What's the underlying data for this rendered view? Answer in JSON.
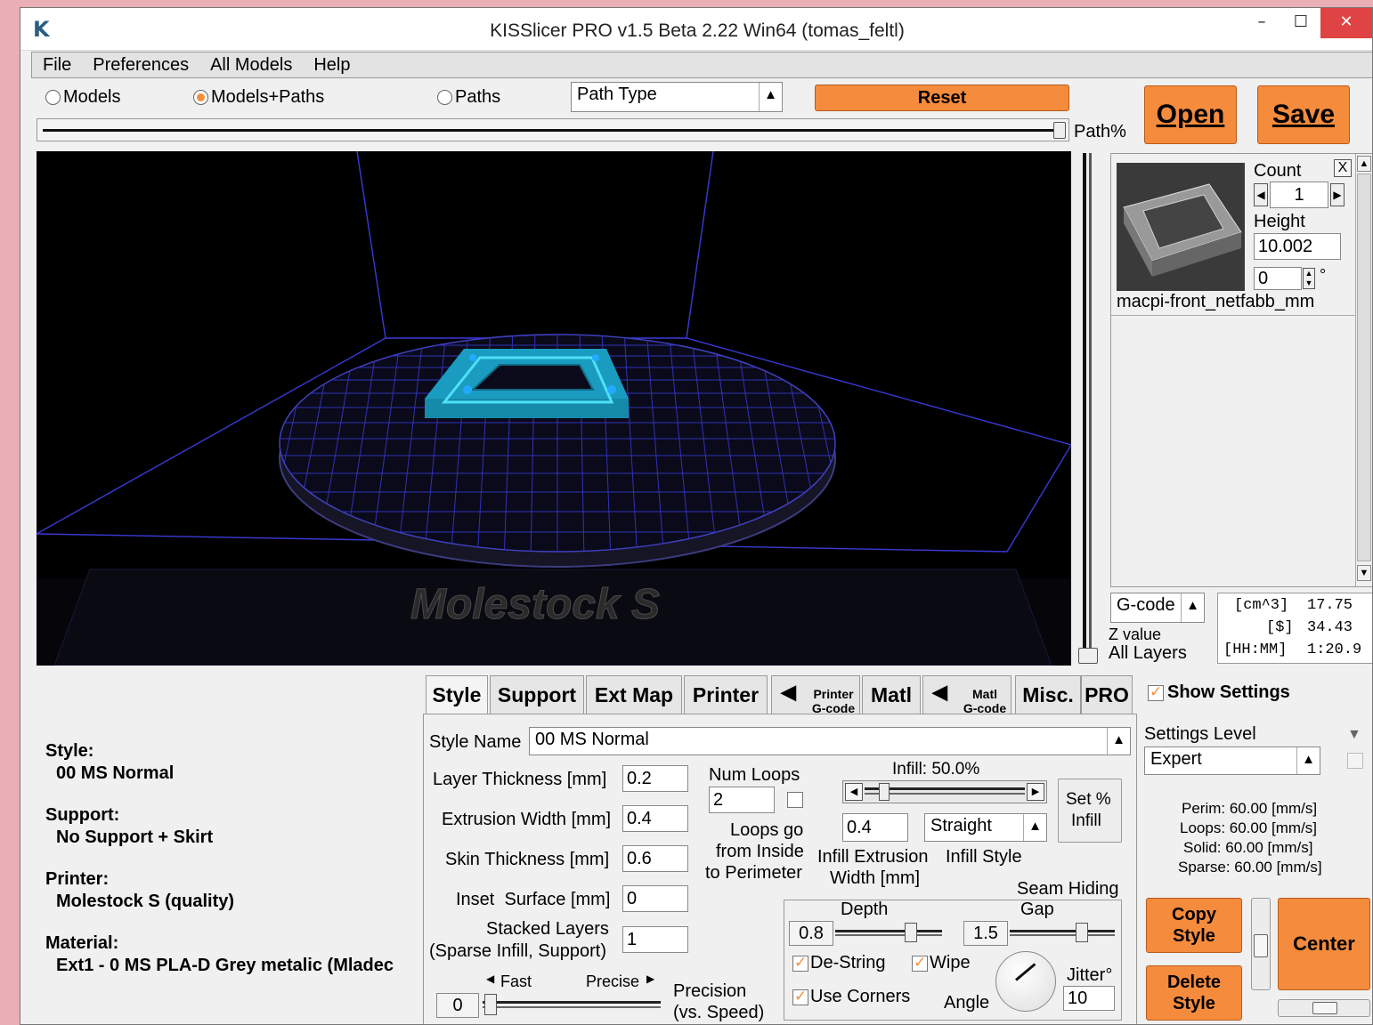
{
  "window": {
    "title": "KISSlicer PRO v1.5 Beta 2.22 Win64 (tomas_feltl)",
    "app_icon": "K"
  },
  "titlebar_buttons": {
    "minimize": "–",
    "maximize": "☐",
    "close": "✕"
  },
  "menu": [
    "File",
    "Preferences",
    "All Models",
    "Help"
  ],
  "view_modes": [
    {
      "label": "Models",
      "selected": false
    },
    {
      "label": "Models+Paths",
      "selected": true
    },
    {
      "label": "Paths",
      "selected": false
    }
  ],
  "path_type": {
    "value": "Path Type"
  },
  "reset_label": "Reset",
  "open_label": "Open",
  "save_label": "Save",
  "path_slider": {
    "label": "Path%",
    "value_percent": 100
  },
  "viewport": {
    "bed_label": "Molestock S"
  },
  "model_panel": {
    "count_label": "Count",
    "count": "1",
    "close_label": "X",
    "height_label": "Height",
    "height": "10.002",
    "rotation": "0",
    "degree": "°",
    "model_name": "macpi-front_netfabb_mm"
  },
  "gcode_select": {
    "value": "G-code"
  },
  "z_value_label": "Z value",
  "z_value": "All Layers",
  "stats": {
    "volume_label": "[cm^3]",
    "volume": "17.75",
    "cost_label": "[$]",
    "cost": "34.43",
    "time_label": "[HH:MM]",
    "time": "1:20.9"
  },
  "summary": {
    "style_label": "Style:",
    "style": "00 MS Normal",
    "support_label": "Support:",
    "support": "No Support + Skirt",
    "printer_label": "Printer:",
    "printer": "Molestock S (quality)",
    "material_label": "Material:",
    "material": "Ext1 - 0 MS PLA-D Grey metalic (Mladec"
  },
  "tabs": {
    "style": "Style",
    "support": "Support",
    "ext_map": "Ext Map",
    "printer": "Printer",
    "printer_gcode_1": "Printer",
    "printer_gcode_2": "G-code",
    "matl": "Matl",
    "matl_gcode_1": "Matl",
    "matl_gcode_2": "G-code",
    "misc": "Misc.",
    "pro": "PRO"
  },
  "style_tab": {
    "style_name_label": "Style Name",
    "style_name": "00 MS Normal",
    "layer_thickness_label": "Layer Thickness [mm]",
    "layer_thickness": "0.2",
    "extrusion_width_label": "Extrusion Width [mm]",
    "extrusion_width": "0.4",
    "skin_thickness_label": "Skin Thickness [mm]",
    "skin_thickness": "0.6",
    "inset_surface_label": "Inset  Surface [mm]",
    "inset_surface": "0",
    "stacked_layers_label_1": "Stacked Layers",
    "stacked_layers_label_2": "(Sparse Infill, Support)",
    "stacked_layers": "1",
    "num_loops_label": "Num Loops",
    "num_loops": "2",
    "loops_go_1": "Loops go",
    "loops_go_2": "from Inside",
    "loops_go_3": "to Perimeter",
    "infill_label": "Infill: 50.0%",
    "infill_percent": 50,
    "set_infill_1": "Set %",
    "set_infill_2": "Infill",
    "infill_extrusion_width": "0.4",
    "infill_extrusion_label_1": "Infill Extrusion",
    "infill_extrusion_label_2": "Width [mm]",
    "infill_style": "Straight",
    "infill_style_label": "Infill Style",
    "seam_hiding_label": "Seam Hiding",
    "depth_label": "Depth",
    "depth": "0.8",
    "gap_label": "Gap",
    "gap": "1.5",
    "destring_label": "De-String",
    "wipe_label": "Wipe",
    "use_corners_label": "Use Corners",
    "angle_label": "Angle",
    "jitter_label": "Jitter°",
    "jitter": "10",
    "fast_label": "Fast",
    "precise_label": "Precise",
    "precision_value": "0",
    "precision_label_1": "Precision",
    "precision_label_2": "(vs. Speed)"
  },
  "settings": {
    "show_settings_label": "Show Settings",
    "level_label": "Settings Level",
    "level": "Expert",
    "speeds": [
      "Perim:  60.00 [mm/s]",
      "Loops:  60.00 [mm/s]",
      "Solid:  60.00 [mm/s]",
      "Sparse: 60.00 [mm/s]"
    ]
  },
  "copy_style_1": "Copy",
  "copy_style_2": "Style",
  "delete_style_1": "Delete",
  "delete_style_2": "Style",
  "center_label": "Center",
  "colors": {
    "accent": "#f58b3c",
    "wireframe": "#3a3ad8",
    "model": "#22c8e6"
  }
}
